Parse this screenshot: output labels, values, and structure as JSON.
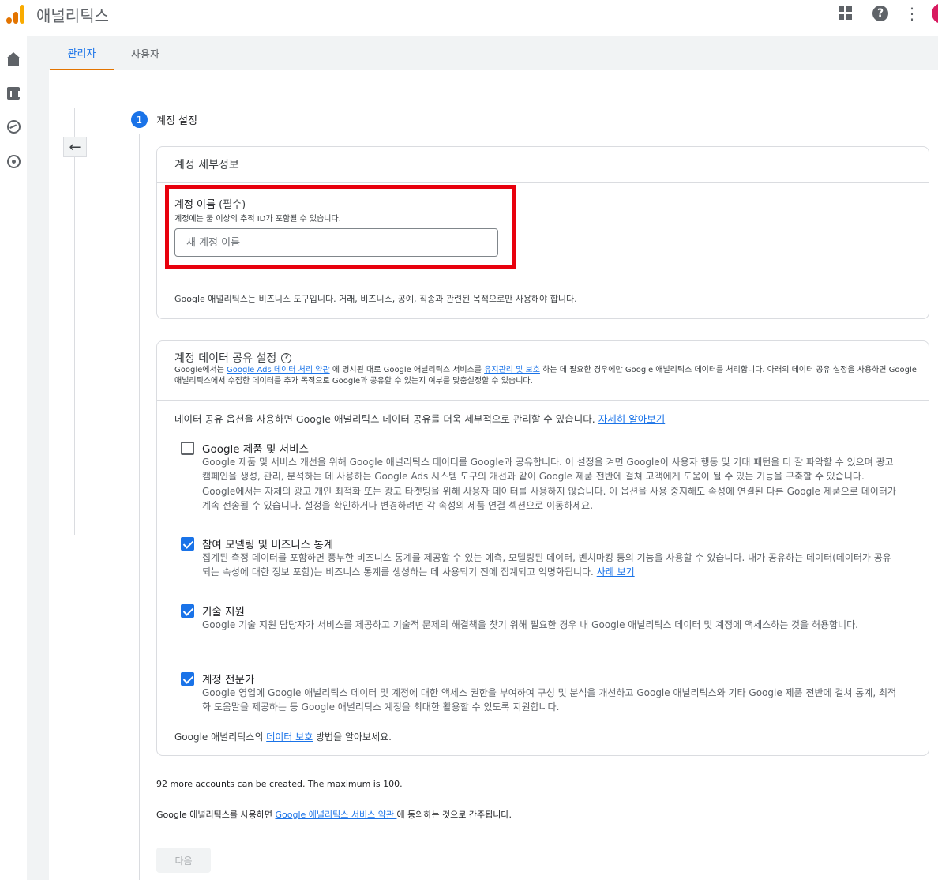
{
  "app": {
    "title": "애널리틱스"
  },
  "tabs": [
    {
      "label": "관리자",
      "active": true
    },
    {
      "label": "사용자",
      "active": false
    }
  ],
  "step": {
    "number": "1",
    "title": "계정 설정"
  },
  "account_details": {
    "heading": "계정 세부정보",
    "field_label": "계정 이름",
    "field_required": "(필수)",
    "field_help": "계정에는 둘 이상의 추적 ID가 포함될 수 있습니다.",
    "placeholder": "새 계정 이름",
    "biz_note": "Google 애널리틱스는 비즈니스 도구입니다. 거래, 비즈니스, 공예, 직종과 관련된 목적으로만 사용해야 합니다."
  },
  "data_sharing": {
    "heading": "계정 데이터 공유 설정",
    "desc_1": "Google에서는 ",
    "desc_link1": "Google Ads 데이터 처리 약관",
    "desc_2": " 에 명시된 대로 Google 애널리틱스 서비스를 ",
    "desc_link2": "유지관리 및 보호",
    "desc_3": " 하는 데 필요한 경우에만 Google 애널리틱스 데이터를 처리합니다. 아래의 데이터 공유 설정을 사용하면 Google 애널리틱스에서 수집한 데이터를 추가 목적으로 Google과 공유할 수 있는지 여부를 맞춤설정할 수 있습니다.",
    "intro": "데이터 공유 옵션을 사용하면 Google 애널리틱스 데이터 공유를 더욱 세부적으로 관리할 수 있습니다. ",
    "intro_link": "자세히 알아보기",
    "options": [
      {
        "title": "Google 제품 및 서비스",
        "desc": "Google 제품 및 서비스 개선을 위해 Google 애널리틱스 데이터를 Google과 공유합니다. 이 설정을 켜면 Google이 사용자 행동 및 기대 패턴을 더 잘 파악할 수 있으며 광고 캠페인을 생성, 관리, 분석하는 데 사용하는 Google Ads 시스템 도구의 개선과 같이 Google 제품 전반에 걸쳐 고객에게 도움이 될 수 있는 기능을 구축할 수 있습니다. Google에서는 자체의 광고 개인 최적화 또는 광고 타겟팅을 위해 사용자 데이터를 사용하지 않습니다. 이 옵션을 사용 중지해도 속성에 연결된 다른 Google 제품으로 데이터가 계속 전송될 수 있습니다. 설정을 확인하거나 변경하려면 각 속성의 제품 연결 섹션으로 이동하세요.",
        "link": "",
        "checked": false
      },
      {
        "title": "참여 모델링 및 비즈니스 통계",
        "desc": "집계된 측정 데이터를 포함하면 풍부한 비즈니스 통계를 제공할 수 있는 예측, 모델링된 데이터, 벤치마킹 등의 기능을 사용할 수 있습니다. 내가 공유하는 데이터(데이터가 공유되는 속성에 대한 정보 포함)는 비즈니스 통계를 생성하는 데 사용되기 전에 집계되고 익명화됩니다. ",
        "link": "사례 보기",
        "checked": true
      },
      {
        "title": "기술 지원",
        "desc": "Google 기술 지원 담당자가 서비스를 제공하고 기술적 문제의 해결책을 찾기 위해 필요한 경우 내 Google 애널리틱스 데이터 및 계정에 액세스하는 것을 허용합니다.",
        "link": "",
        "checked": true
      },
      {
        "title": "계정 전문가",
        "desc": "Google 영업에 Google 애널리틱스 데이터 및 계정에 대한 액세스 권한을 부여하여 구성 및 분석을 개선하고 Google 애널리틱스와 기타 Google 제품 전반에 걸쳐 통계, 최적화 도움말을 제공하는 등 Google 애널리틱스 계정을 최대한 활용할 수 있도록 지원합니다.",
        "link": "",
        "checked": true
      }
    ],
    "protect_1": "Google 애널리틱스의 ",
    "protect_link": "데이터 보호",
    "protect_2": " 방법을 알아보세요."
  },
  "footer": {
    "accounts_note": "92 more accounts can be created. The maximum is 100.",
    "terms_1": "Google 애널리틱스를 사용하면 ",
    "terms_link": "Google 애널리틱스 서비스 약관 ",
    "terms_2": "에 동의하는 것으로 간주됩니다.",
    "next_label": "다음"
  },
  "colors": {
    "accent": "#1a73e8",
    "highlight": "#e8000d",
    "tab_underline": "#e37400"
  }
}
